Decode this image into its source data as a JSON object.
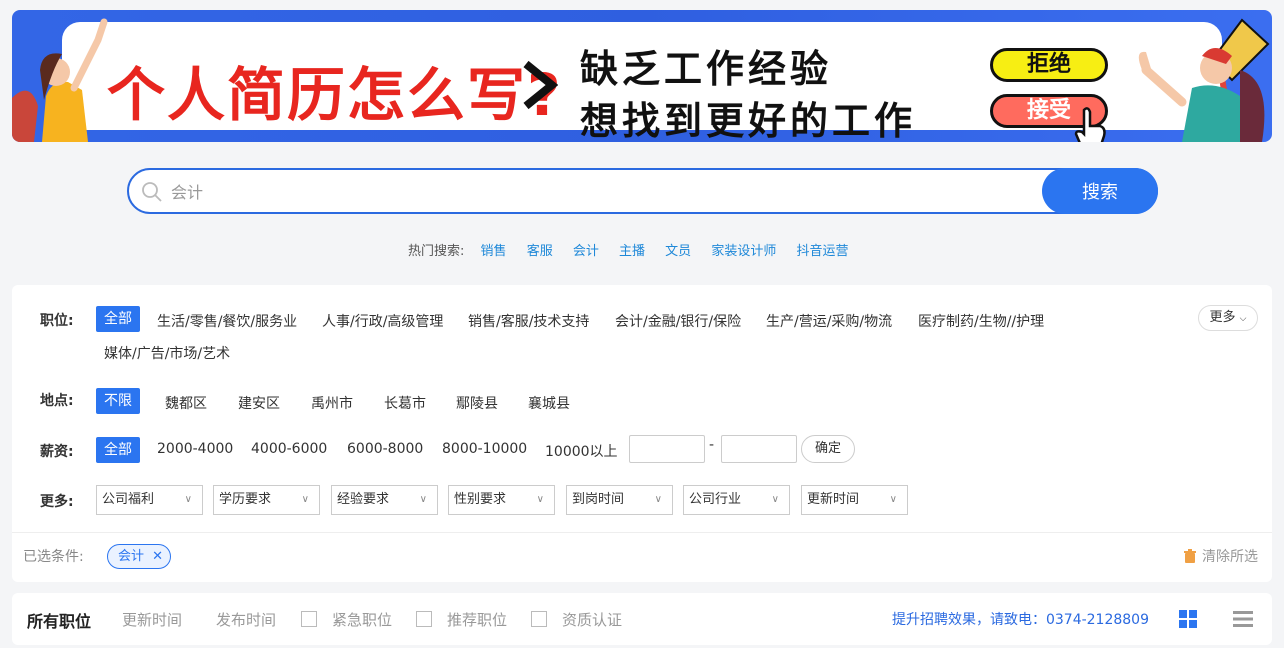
{
  "banner": {
    "title": "个人简历怎么写?",
    "line1": "缺乏工作经验",
    "line2": "想找到更好的工作",
    "reject": "拒绝",
    "accept": "接受"
  },
  "search": {
    "value": "会计",
    "button": "搜索"
  },
  "hot": {
    "label": "热门搜索:",
    "items": [
      "销售",
      "客服",
      "会计",
      "主播",
      "文员",
      "家装设计师",
      "抖音运营"
    ]
  },
  "filters": {
    "position": {
      "label": "职位:",
      "all": "全部",
      "items": [
        "生活/零售/餐饮/服务业",
        "人事/行政/高级管理",
        "销售/客服/技术支持",
        "会计/金融/银行/保险",
        "生产/营运/采购/物流",
        "医疗制药/生物//护理",
        "媒体/广告/市场/艺术"
      ],
      "more": "更多"
    },
    "location": {
      "label": "地点:",
      "all": "不限",
      "items": [
        "魏都区",
        "建安区",
        "禹州市",
        "长葛市",
        "鄢陵县",
        "襄城县"
      ]
    },
    "salary": {
      "label": "薪资:",
      "all": "全部",
      "items": [
        "2000-4000",
        "4000-6000",
        "6000-8000",
        "8000-10000",
        "10000以上"
      ],
      "dash": "-",
      "confirm": "确定"
    },
    "more": {
      "label": "更多:",
      "dropdowns": [
        "公司福利",
        "学历要求",
        "经验要求",
        "性别要求",
        "到岗时间",
        "公司行业",
        "更新时间"
      ]
    },
    "selected": {
      "label": "已选条件:",
      "tag": "会计",
      "clear": "清除所选"
    }
  },
  "bar": {
    "title": "所有职位",
    "sort1": "更新时间",
    "sort2": "发布时间",
    "check1": "紧急职位",
    "check2": "推荐职位",
    "check3": "资质认证",
    "contact": "提升招聘效果，请致电：0374-2128809"
  },
  "colors": {
    "accent": "#2b75f0",
    "banner_red": "#e8261f"
  }
}
